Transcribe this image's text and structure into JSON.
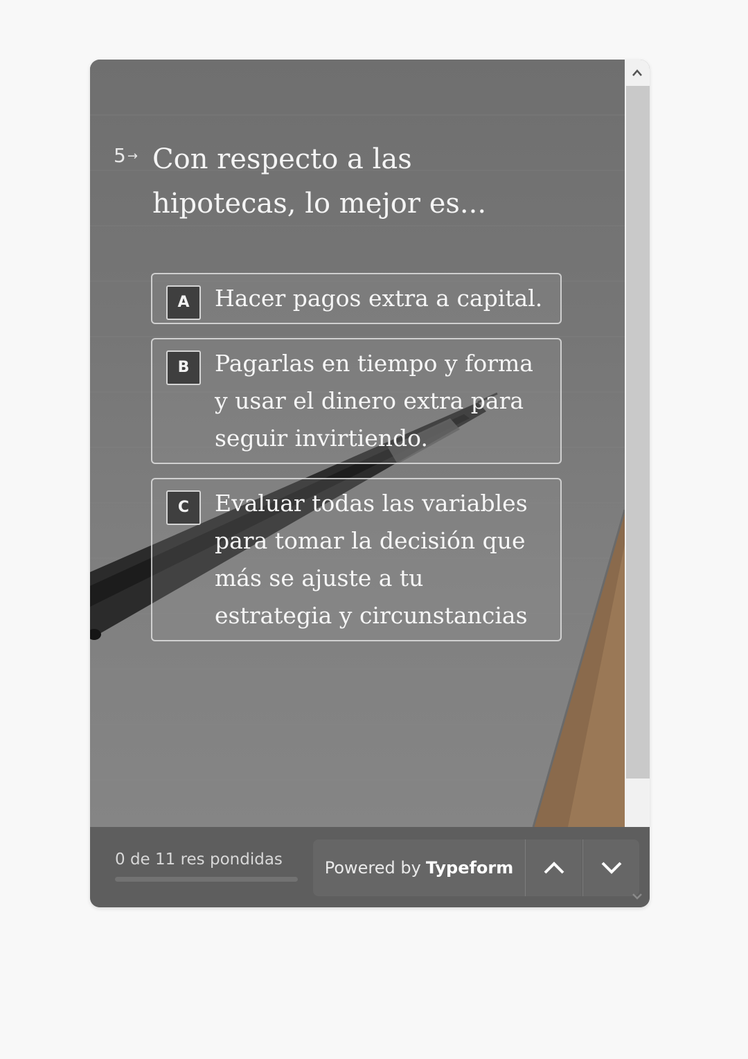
{
  "question": {
    "number": "5",
    "text": "Con respecto a las hipotecas, lo mejor es..."
  },
  "choices": [
    {
      "key": "A",
      "label": "Hacer pagos extra a capital."
    },
    {
      "key": "B",
      "label": "Pagarlas en tiempo y forma y usar el dinero extra para seguir invirtiendo."
    },
    {
      "key": "C",
      "label": "Evaluar todas las variables para tomar la decisión que más se ajuste a tu estrategia y circunstancias"
    }
  ],
  "footer": {
    "progress_text": "0 de 11 res pondidas",
    "answered": 0,
    "total": 11,
    "powered_prefix": "Powered by",
    "powered_brand": "Typeform"
  },
  "icons": {
    "question_arrow": "arrow-right-icon",
    "nav_up": "chevron-up-icon",
    "nav_down": "chevron-down-icon",
    "scroll_up": "scroll-up-arrow-icon",
    "scroll_down": "scroll-down-arrow-icon"
  },
  "colors": {
    "footer_bg": "#5e5e5e",
    "button_bg": "#666666",
    "choice_key_bg": "#3f3f3f",
    "text": "#f4f4f4"
  }
}
